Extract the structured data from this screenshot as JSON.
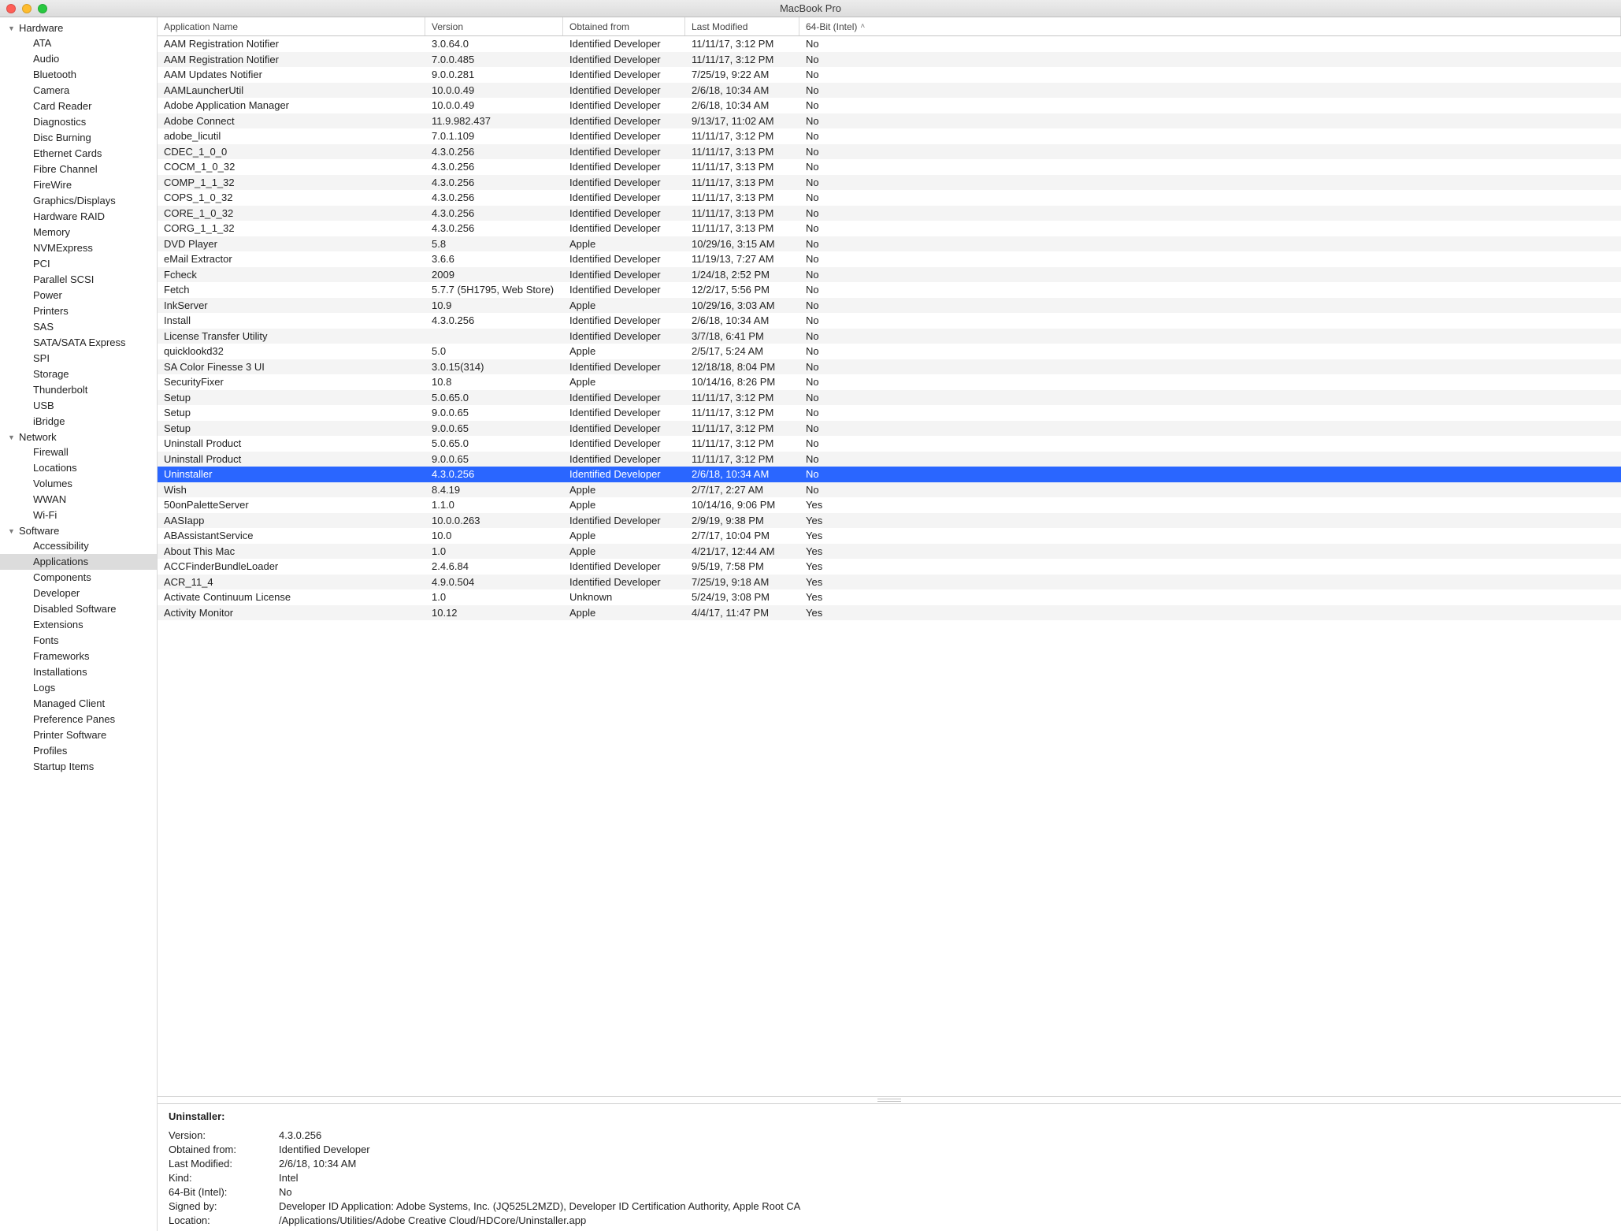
{
  "window_title": "MacBook Pro",
  "sidebar": [
    {
      "header": "Hardware",
      "items": [
        "ATA",
        "Audio",
        "Bluetooth",
        "Camera",
        "Card Reader",
        "Diagnostics",
        "Disc Burning",
        "Ethernet Cards",
        "Fibre Channel",
        "FireWire",
        "Graphics/Displays",
        "Hardware RAID",
        "Memory",
        "NVMExpress",
        "PCI",
        "Parallel SCSI",
        "Power",
        "Printers",
        "SAS",
        "SATA/SATA Express",
        "SPI",
        "Storage",
        "Thunderbolt",
        "USB",
        "iBridge"
      ]
    },
    {
      "header": "Network",
      "items": [
        "Firewall",
        "Locations",
        "Volumes",
        "WWAN",
        "Wi-Fi"
      ]
    },
    {
      "header": "Software",
      "items": [
        "Accessibility",
        "Applications",
        "Components",
        "Developer",
        "Disabled Software",
        "Extensions",
        "Fonts",
        "Frameworks",
        "Installations",
        "Logs",
        "Managed Client",
        "Preference Panes",
        "Printer Software",
        "Profiles",
        "Startup Items"
      ]
    }
  ],
  "selected_sidebar": "Applications",
  "columns": [
    "Application Name",
    "Version",
    "Obtained from",
    "Last Modified",
    "64-Bit (Intel)"
  ],
  "sort_column": 4,
  "rows": [
    {
      "name": "AAM Registration Notifier",
      "version": "3.0.64.0",
      "obtained": "Identified Developer",
      "modified": "11/11/17, 3:12 PM",
      "x64": "No"
    },
    {
      "name": "AAM Registration Notifier",
      "version": "7.0.0.485",
      "obtained": "Identified Developer",
      "modified": "11/11/17, 3:12 PM",
      "x64": "No"
    },
    {
      "name": "AAM Updates Notifier",
      "version": "9.0.0.281",
      "obtained": "Identified Developer",
      "modified": "7/25/19, 9:22 AM",
      "x64": "No"
    },
    {
      "name": "AAMLauncherUtil",
      "version": "10.0.0.49",
      "obtained": "Identified Developer",
      "modified": "2/6/18, 10:34 AM",
      "x64": "No"
    },
    {
      "name": "Adobe Application Manager",
      "version": "10.0.0.49",
      "obtained": "Identified Developer",
      "modified": "2/6/18, 10:34 AM",
      "x64": "No"
    },
    {
      "name": "Adobe Connect",
      "version": "11.9.982.437",
      "obtained": "Identified Developer",
      "modified": "9/13/17, 11:02 AM",
      "x64": "No"
    },
    {
      "name": "adobe_licutil",
      "version": "7.0.1.109",
      "obtained": "Identified Developer",
      "modified": "11/11/17, 3:12 PM",
      "x64": "No"
    },
    {
      "name": "CDEC_1_0_0",
      "version": "4.3.0.256",
      "obtained": "Identified Developer",
      "modified": "11/11/17, 3:13 PM",
      "x64": "No"
    },
    {
      "name": "COCM_1_0_32",
      "version": "4.3.0.256",
      "obtained": "Identified Developer",
      "modified": "11/11/17, 3:13 PM",
      "x64": "No"
    },
    {
      "name": "COMP_1_1_32",
      "version": "4.3.0.256",
      "obtained": "Identified Developer",
      "modified": "11/11/17, 3:13 PM",
      "x64": "No"
    },
    {
      "name": "COPS_1_0_32",
      "version": "4.3.0.256",
      "obtained": "Identified Developer",
      "modified": "11/11/17, 3:13 PM",
      "x64": "No"
    },
    {
      "name": "CORE_1_0_32",
      "version": "4.3.0.256",
      "obtained": "Identified Developer",
      "modified": "11/11/17, 3:13 PM",
      "x64": "No"
    },
    {
      "name": "CORG_1_1_32",
      "version": "4.3.0.256",
      "obtained": "Identified Developer",
      "modified": "11/11/17, 3:13 PM",
      "x64": "No"
    },
    {
      "name": "DVD Player",
      "version": "5.8",
      "obtained": "Apple",
      "modified": "10/29/16, 3:15 AM",
      "x64": "No"
    },
    {
      "name": "eMail Extractor",
      "version": "3.6.6",
      "obtained": "Identified Developer",
      "modified": "11/19/13, 7:27 AM",
      "x64": "No"
    },
    {
      "name": "Fcheck",
      "version": "2009",
      "obtained": "Identified Developer",
      "modified": "1/24/18, 2:52 PM",
      "x64": "No"
    },
    {
      "name": "Fetch",
      "version": "5.7.7 (5H1795, Web Store)",
      "obtained": "Identified Developer",
      "modified": "12/2/17, 5:56 PM",
      "x64": "No"
    },
    {
      "name": "InkServer",
      "version": "10.9",
      "obtained": "Apple",
      "modified": "10/29/16, 3:03 AM",
      "x64": "No"
    },
    {
      "name": "Install",
      "version": "4.3.0.256",
      "obtained": "Identified Developer",
      "modified": "2/6/18, 10:34 AM",
      "x64": "No"
    },
    {
      "name": "License Transfer Utility",
      "version": "",
      "obtained": "Identified Developer",
      "modified": "3/7/18, 6:41 PM",
      "x64": "No"
    },
    {
      "name": "quicklookd32",
      "version": "5.0",
      "obtained": "Apple",
      "modified": "2/5/17, 5:24 AM",
      "x64": "No"
    },
    {
      "name": "SA Color Finesse 3 UI",
      "version": "3.0.15(314)",
      "obtained": "Identified Developer",
      "modified": "12/18/18, 8:04 PM",
      "x64": "No"
    },
    {
      "name": "SecurityFixer",
      "version": "10.8",
      "obtained": "Apple",
      "modified": "10/14/16, 8:26 PM",
      "x64": "No"
    },
    {
      "name": "Setup",
      "version": "5.0.65.0",
      "obtained": "Identified Developer",
      "modified": "11/11/17, 3:12 PM",
      "x64": "No"
    },
    {
      "name": "Setup",
      "version": "9.0.0.65",
      "obtained": "Identified Developer",
      "modified": "11/11/17, 3:12 PM",
      "x64": "No"
    },
    {
      "name": "Setup",
      "version": "9.0.0.65",
      "obtained": "Identified Developer",
      "modified": "11/11/17, 3:12 PM",
      "x64": "No"
    },
    {
      "name": "Uninstall Product",
      "version": "5.0.65.0",
      "obtained": "Identified Developer",
      "modified": "11/11/17, 3:12 PM",
      "x64": "No"
    },
    {
      "name": "Uninstall Product",
      "version": "9.0.0.65",
      "obtained": "Identified Developer",
      "modified": "11/11/17, 3:12 PM",
      "x64": "No"
    },
    {
      "name": "Uninstaller",
      "version": "4.3.0.256",
      "obtained": "Identified Developer",
      "modified": "2/6/18, 10:34 AM",
      "x64": "No"
    },
    {
      "name": "Wish",
      "version": "8.4.19",
      "obtained": "Apple",
      "modified": "2/7/17, 2:27 AM",
      "x64": "No"
    },
    {
      "name": "50onPaletteServer",
      "version": "1.1.0",
      "obtained": "Apple",
      "modified": "10/14/16, 9:06 PM",
      "x64": "Yes"
    },
    {
      "name": "AASIapp",
      "version": "10.0.0.263",
      "obtained": "Identified Developer",
      "modified": "2/9/19, 9:38 PM",
      "x64": "Yes"
    },
    {
      "name": "ABAssistantService",
      "version": "10.0",
      "obtained": "Apple",
      "modified": "2/7/17, 10:04 PM",
      "x64": "Yes"
    },
    {
      "name": "About This Mac",
      "version": "1.0",
      "obtained": "Apple",
      "modified": "4/21/17, 12:44 AM",
      "x64": "Yes"
    },
    {
      "name": "ACCFinderBundleLoader",
      "version": "2.4.6.84",
      "obtained": "Identified Developer",
      "modified": "9/5/19, 7:58 PM",
      "x64": "Yes"
    },
    {
      "name": "ACR_11_4",
      "version": "4.9.0.504",
      "obtained": "Identified Developer",
      "modified": "7/25/19, 9:18 AM",
      "x64": "Yes"
    },
    {
      "name": "Activate Continuum License",
      "version": "1.0",
      "obtained": "Unknown",
      "modified": "5/24/19, 3:08 PM",
      "x64": "Yes"
    },
    {
      "name": "Activity Monitor",
      "version": "10.12",
      "obtained": "Apple",
      "modified": "4/4/17, 11:47 PM",
      "x64": "Yes"
    }
  ],
  "selected_row": 28,
  "details": {
    "title": "Uninstaller:",
    "fields": [
      {
        "k": "Version:",
        "v": "4.3.0.256"
      },
      {
        "k": "Obtained from:",
        "v": "Identified Developer"
      },
      {
        "k": "Last Modified:",
        "v": "2/6/18, 10:34 AM"
      },
      {
        "k": "Kind:",
        "v": "Intel"
      },
      {
        "k": "64-Bit (Intel):",
        "v": "No"
      },
      {
        "k": "Signed by:",
        "v": "Developer ID Application: Adobe Systems, Inc. (JQ525L2MZD), Developer ID Certification Authority, Apple Root CA"
      },
      {
        "k": "Location:",
        "v": "/Applications/Utilities/Adobe Creative Cloud/HDCore/Uninstaller.app"
      }
    ]
  }
}
